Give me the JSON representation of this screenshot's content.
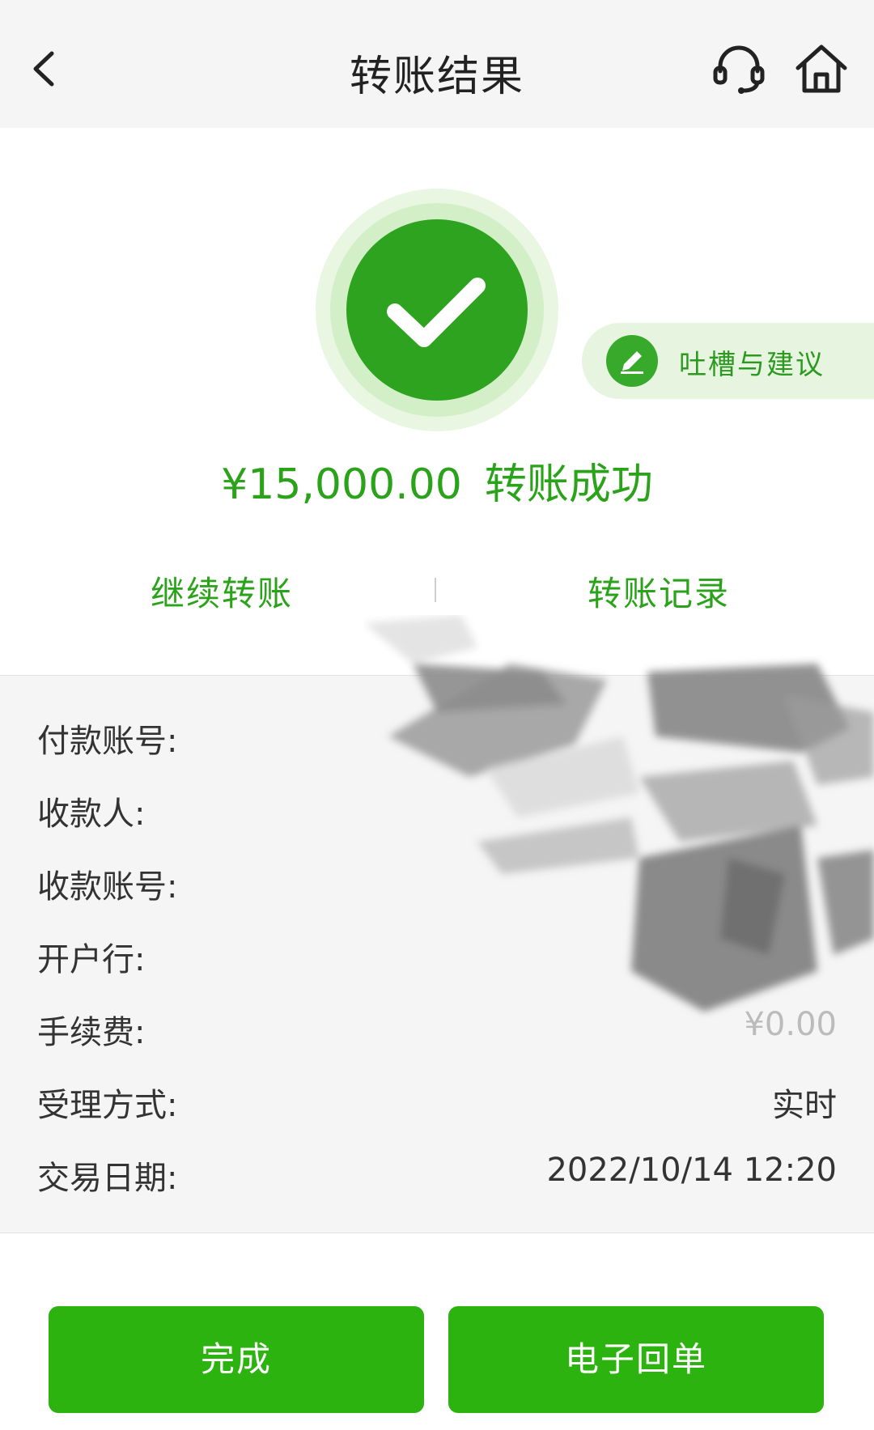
{
  "header": {
    "title": "转账结果",
    "back_icon": "chevron-left-icon",
    "support_icon": "headset-icon",
    "home_icon": "home-icon"
  },
  "success": {
    "icon": "checkmark-icon",
    "amount": "¥15,000.00",
    "status": "转账成功"
  },
  "feedback": {
    "label": "吐槽与建议",
    "icon": "pencil-icon"
  },
  "actions": {
    "continue_label": "继续转账",
    "records_label": "转账记录"
  },
  "details": [
    {
      "label": "付款账号:",
      "value": ""
    },
    {
      "label": "收款人:",
      "value": ""
    },
    {
      "label": "收款账号:",
      "value": ""
    },
    {
      "label": "开户行:",
      "value": ""
    },
    {
      "label": "手续费:",
      "value": "¥0.00"
    },
    {
      "label": "受理方式:",
      "value": "实时"
    },
    {
      "label": "交易日期:",
      "value": "2022/10/14 12:20"
    }
  ],
  "buttons": {
    "done_label": "完成",
    "receipt_label": "电子回单"
  },
  "colors": {
    "accent": "#2aa31a",
    "button": "#2db30f",
    "header_bg": "#f5f5f5",
    "detail_bg": "#f5f5f5"
  }
}
